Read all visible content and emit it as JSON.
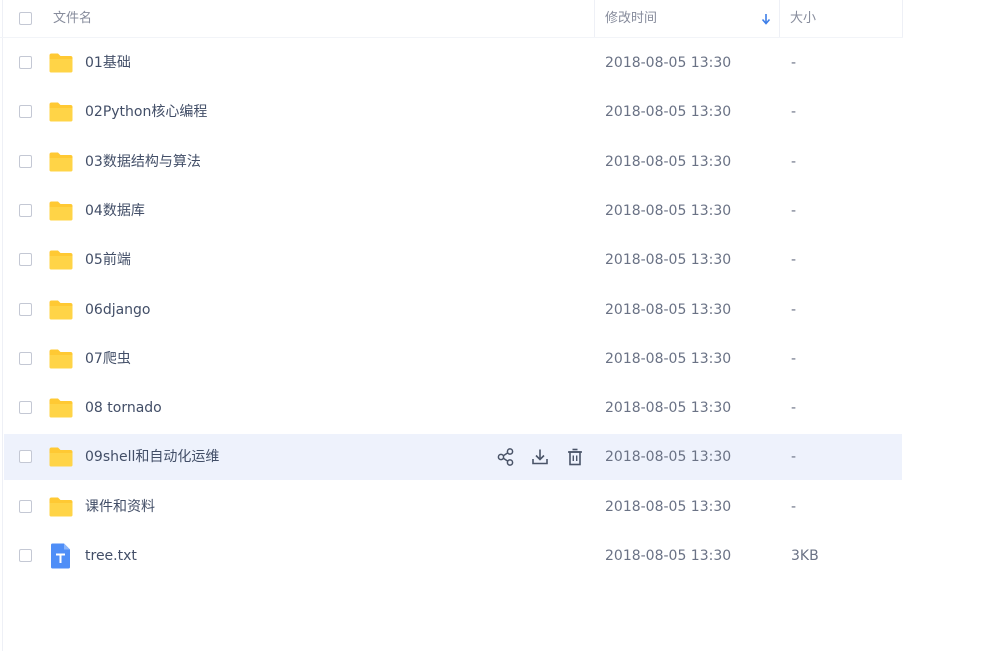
{
  "header": {
    "name_label": "文件名",
    "time_label": "修改时间",
    "size_label": "大小"
  },
  "colors": {
    "folder": "#ffc933",
    "file_icon": "#4f8ef7",
    "hover_row": "#eef2fc",
    "sort_arrow": "#3d7ee8"
  },
  "files": [
    {
      "name": "01基础",
      "time": "2018-08-05 13:30",
      "size": "-",
      "icon": "folder-icon"
    },
    {
      "name": "02Python核心编程",
      "time": "2018-08-05 13:30",
      "size": "-",
      "icon": "folder-icon"
    },
    {
      "name": "03数据结构与算法",
      "time": "2018-08-05 13:30",
      "size": "-",
      "icon": "folder-icon"
    },
    {
      "name": "04数据库",
      "time": "2018-08-05 13:30",
      "size": "-",
      "icon": "folder-icon"
    },
    {
      "name": "05前端",
      "time": "2018-08-05 13:30",
      "size": "-",
      "icon": "folder-icon"
    },
    {
      "name": "06django",
      "time": "2018-08-05 13:30",
      "size": "-",
      "icon": "folder-icon"
    },
    {
      "name": "07爬虫",
      "time": "2018-08-05 13:30",
      "size": "-",
      "icon": "folder-icon"
    },
    {
      "name": "08 tornado",
      "time": "2018-08-05 13:30",
      "size": "-",
      "icon": "folder-icon"
    },
    {
      "name": "09shell和自动化运维",
      "time": "2018-08-05 13:30",
      "size": "-",
      "icon": "folder-icon",
      "hovered": true,
      "actions": [
        "share-icon",
        "download-icon",
        "delete-icon"
      ]
    },
    {
      "name": "课件和资料",
      "time": "2018-08-05 13:30",
      "size": "-",
      "icon": "folder-icon"
    },
    {
      "name": "tree.txt",
      "time": "2018-08-05 13:30",
      "size": "3KB",
      "icon": "text-file-icon"
    }
  ]
}
